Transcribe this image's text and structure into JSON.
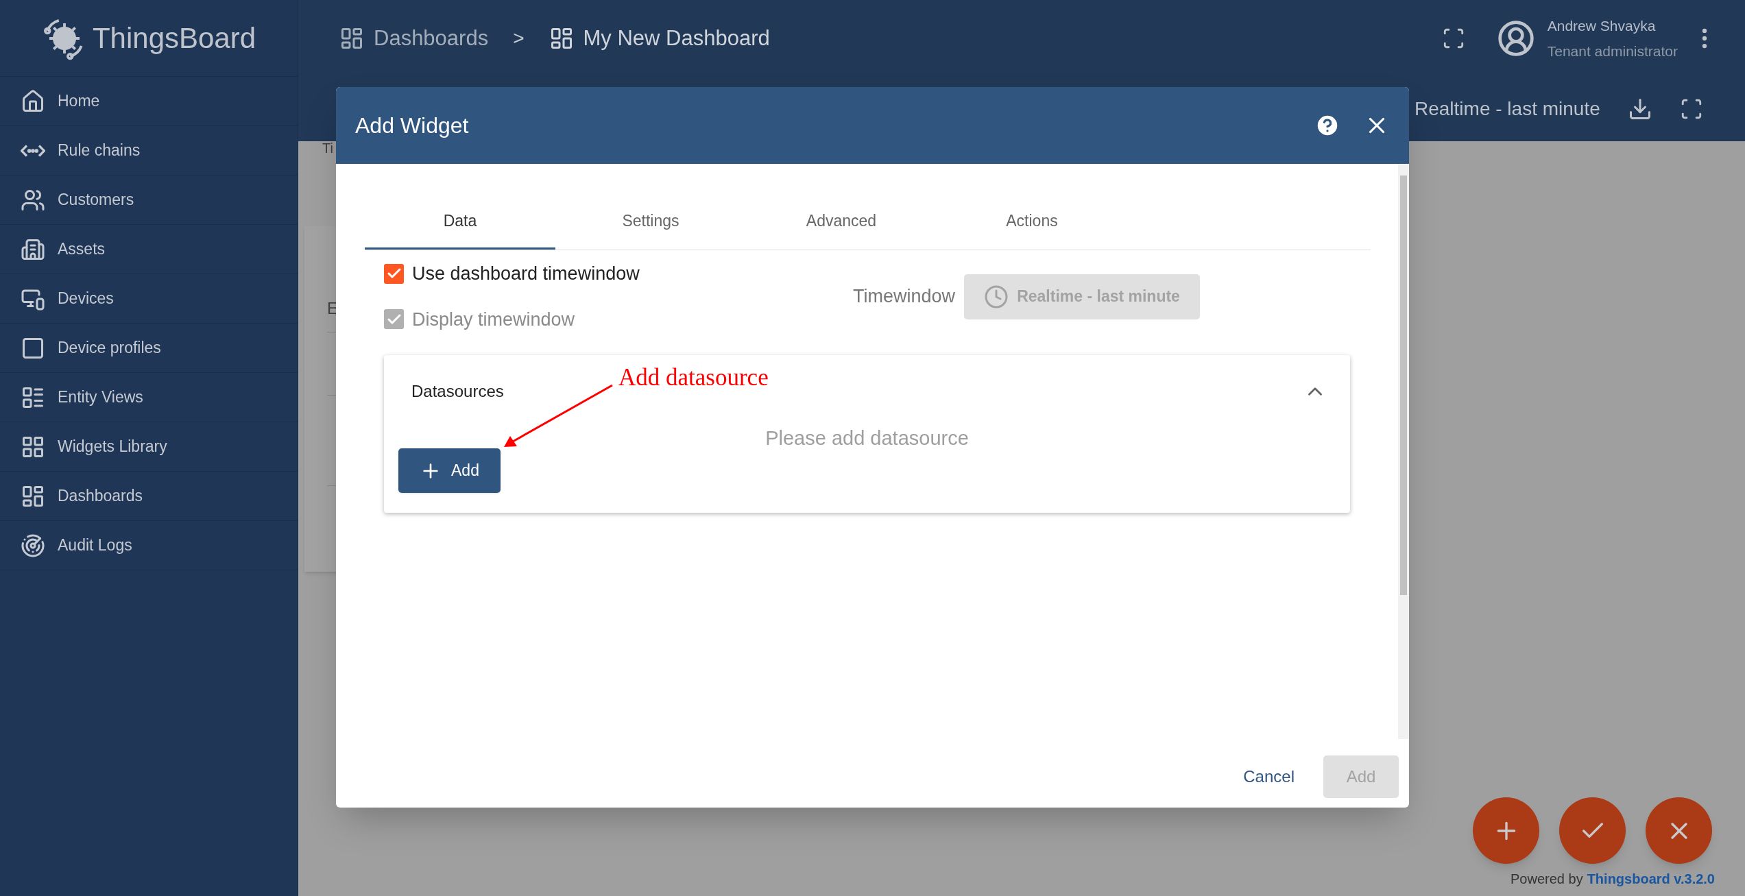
{
  "sidebar": {
    "logo": "ThingsBoard",
    "items": [
      {
        "label": "Home"
      },
      {
        "label": "Rule chains"
      },
      {
        "label": "Customers"
      },
      {
        "label": "Assets"
      },
      {
        "label": "Devices"
      },
      {
        "label": "Device profiles"
      },
      {
        "label": "Entity Views"
      },
      {
        "label": "Widgets Library"
      },
      {
        "label": "Dashboards"
      },
      {
        "label": "Audit Logs"
      }
    ]
  },
  "header": {
    "breadcrumbs": [
      "Dashboards",
      "My New Dashboard"
    ],
    "separator": ">",
    "user": {
      "name": "Andrew Shvayka",
      "role": "Tenant administrator"
    }
  },
  "toolbar": {
    "timewindow": "Realtime - last minute"
  },
  "background": {
    "caption": "Ti",
    "card_rows": [
      "E"
    ]
  },
  "dialog": {
    "title": "Add Widget",
    "tabs": [
      {
        "label": "Data",
        "selected": true
      },
      {
        "label": "Settings",
        "selected": false
      },
      {
        "label": "Advanced",
        "selected": false
      },
      {
        "label": "Actions",
        "selected": false
      }
    ],
    "options": [
      {
        "label": "Use dashboard timewindow",
        "checked": true,
        "disabled": false
      },
      {
        "label": "Display timewindow",
        "checked": true,
        "disabled": true
      }
    ],
    "timewindow": {
      "label": "Timewindow",
      "value": "Realtime - last minute",
      "disabled": true
    },
    "datasources": {
      "title": "Datasources",
      "expanded": true,
      "empty_message": "Please add datasource",
      "add_button": "Add"
    },
    "annotation": "Add datasource",
    "cancel": "Cancel",
    "add": {
      "label": "Add",
      "disabled": true
    }
  },
  "footer": {
    "text": "Powered by",
    "link": "Thingsboard v.3.2.0"
  }
}
